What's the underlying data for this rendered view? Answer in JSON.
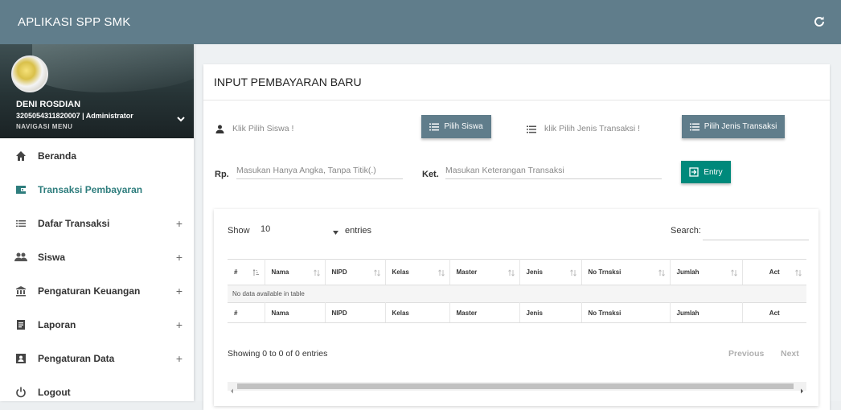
{
  "app": {
    "title": "APLIKASI SPP SMK",
    "refresh_icon": "refresh-icon"
  },
  "user": {
    "name": "DENI ROSDIAN",
    "id_role": "3205054311820007 | Administrator",
    "nav_label": "NAVIGASI MENU"
  },
  "sidebar": {
    "items": [
      {
        "label": "Beranda",
        "icon": "home-icon",
        "has_plus": false,
        "active": false
      },
      {
        "label": "Transaksi Pembayaran",
        "icon": "wallet-icon",
        "has_plus": false,
        "active": true
      },
      {
        "label": "Dafar Transaksi",
        "icon": "list-icon",
        "has_plus": true,
        "active": false
      },
      {
        "label": "Siswa",
        "icon": "people-icon",
        "has_plus": true,
        "active": false
      },
      {
        "label": "Pengaturan Keuangan",
        "icon": "bank-icon",
        "has_plus": true,
        "active": false
      },
      {
        "label": "Laporan",
        "icon": "report-icon",
        "has_plus": true,
        "active": false
      },
      {
        "label": "Pengaturan Data",
        "icon": "data-icon",
        "has_plus": true,
        "active": false
      },
      {
        "label": "Logout",
        "icon": "power-icon",
        "has_plus": false,
        "active": false
      }
    ],
    "plus": "+"
  },
  "form": {
    "title": "INPUT PEMBAYARAN BARU",
    "student_placeholder": "Klik Pilih Siswa !",
    "pick_student_button": "Pilih Siswa",
    "type_placeholder": "klik Pilih Jenis Transaksi !",
    "pick_type_button": "Pilih Jenis Transaksi",
    "amount_prefix": "Rp.",
    "amount_placeholder": "Masukan Hanya Angka, Tanpa Titik(.)",
    "note_prefix": "Ket.",
    "note_placeholder": "Masukan Keterangan Transaksi",
    "entry_button": "Entry"
  },
  "table": {
    "show_label": "Show",
    "length_value": "10",
    "entries_label": "entries",
    "search_label": "Search:",
    "columns": [
      "#",
      "Nama",
      "NIPD",
      "Kelas",
      "Master",
      "Jenis",
      "No Trnsksi",
      "Jumlah",
      "Act"
    ],
    "empty_message": "No data available in table",
    "info": "Showing 0 to 0 of 0 entries",
    "previous": "Previous",
    "next": "Next"
  },
  "colors": {
    "appbar": "#607d8b",
    "button": "#607d8b",
    "entry_button": "#00897b",
    "active_menu": "#2e7d7d"
  }
}
